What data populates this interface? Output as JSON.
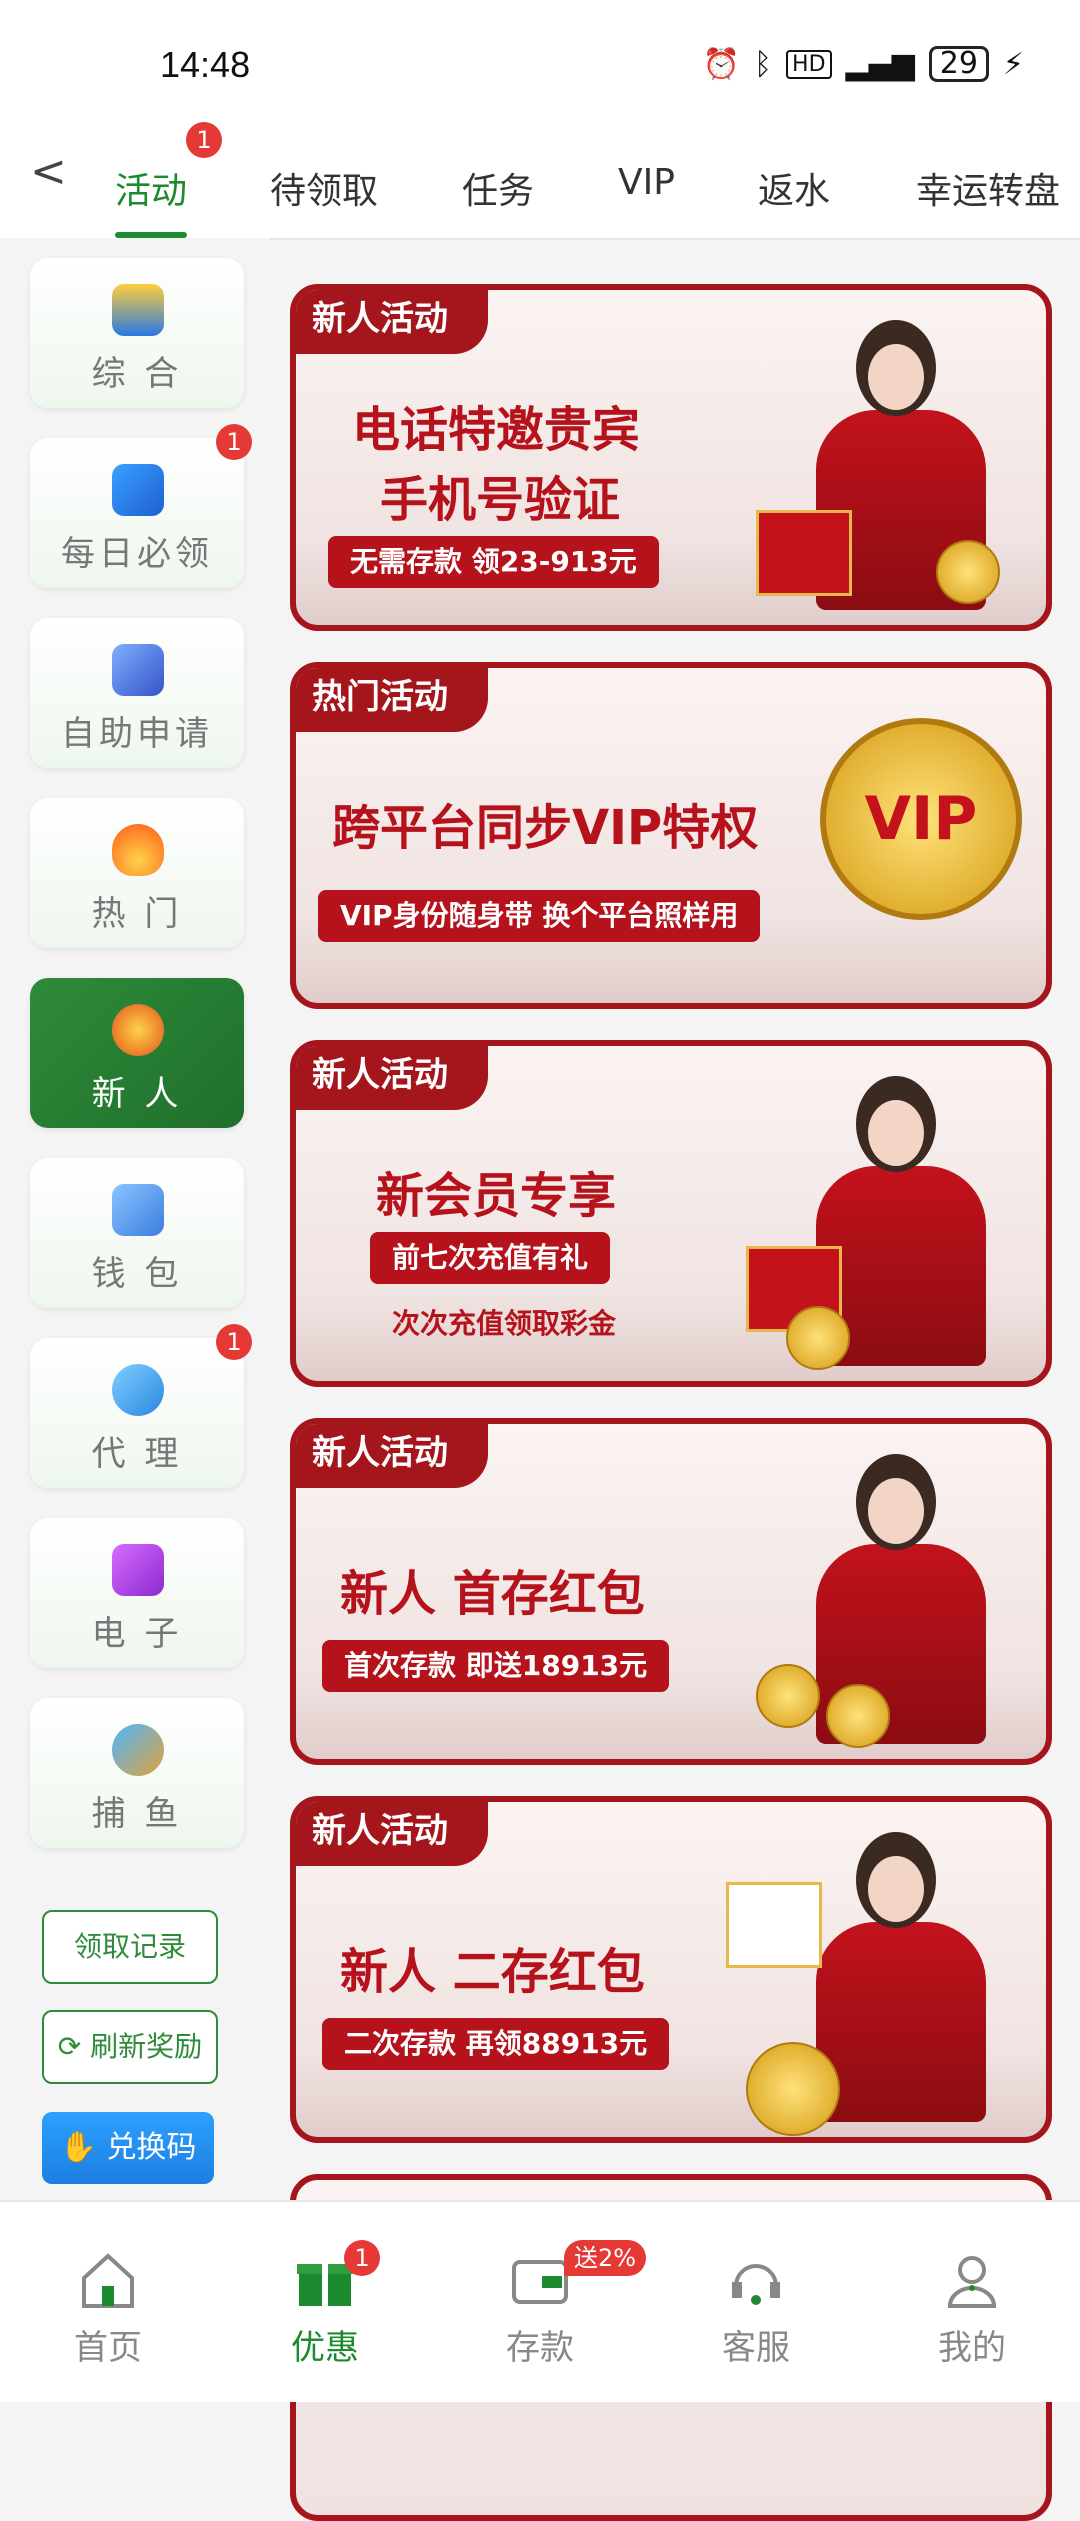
{
  "status_bar": {
    "time": "14:48",
    "battery": "29"
  },
  "top_tabs": [
    {
      "label": "活动",
      "badge": "1"
    },
    {
      "label": "待领取"
    },
    {
      "label": "任务"
    },
    {
      "label": "VIP"
    },
    {
      "label": "返水"
    },
    {
      "label": "幸运转盘"
    }
  ],
  "sidebar": {
    "items": [
      {
        "label": "综 合"
      },
      {
        "label": "每日必领",
        "badge": "1"
      },
      {
        "label": "自助申请"
      },
      {
        "label": "热 门"
      },
      {
        "label": "新 人"
      },
      {
        "label": "钱 包"
      },
      {
        "label": "代 理",
        "badge": "1"
      },
      {
        "label": "电 子"
      },
      {
        "label": "捕 鱼"
      }
    ],
    "record_btn": "领取记录",
    "refresh_btn": "刷新奖励",
    "redeem_btn": "兑换码"
  },
  "banners": [
    {
      "tag": "新人活动",
      "title1": "电话特邀贵宾",
      "title2": "手机号验证",
      "pill": "无需存款 领23-913元"
    },
    {
      "tag": "热门活动",
      "title1": "跨平台同步VIP特权",
      "pill": "VIP身份随身带 换个平台照样用",
      "badge_text": "VIP"
    },
    {
      "tag": "新人活动",
      "title1": "新会员专享",
      "pill": "前七次充值有礼",
      "sub": "次次充值领取彩金"
    },
    {
      "tag": "新人活动",
      "title1": "新人 首存红包",
      "pill": "首次存款 即送18913元"
    },
    {
      "tag": "新人活动",
      "title1": "新人 二存红包",
      "pill": "二次存款 再领88913元"
    }
  ],
  "bottom_nav": [
    {
      "label": "首页"
    },
    {
      "label": "优惠",
      "badge": "1"
    },
    {
      "label": "存款",
      "badge": "送2%"
    },
    {
      "label": "客服"
    },
    {
      "label": "我的"
    }
  ],
  "colors": {
    "accent": "#1c8a2e",
    "banner_red": "#a4151c",
    "badge_red": "#e53935"
  }
}
